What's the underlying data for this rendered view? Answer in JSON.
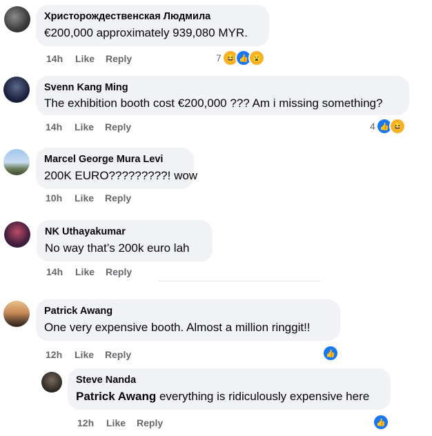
{
  "comments": [
    {
      "author": "Христорождественская Людмила",
      "text": "€200,000 approximately 939,080 MYR.",
      "time": "14h",
      "like": "Like",
      "reply": "Reply",
      "reaction_count": "7",
      "reactions": [
        "haha-icon",
        "like-icon",
        "wow-icon"
      ]
    },
    {
      "author": "Svenn Kang Ming",
      "text": "The exhibition booth cost €200,000 ??? Am i missing something?",
      "time": "14h",
      "like": "Like",
      "reply": "Reply",
      "reaction_count": "4",
      "reactions": [
        "like-icon",
        "haha-icon"
      ]
    },
    {
      "author": "Marcel George Mura Levi",
      "text": "200K EURO?????????! wow",
      "time": "10h",
      "like": "Like",
      "reply": "Reply"
    },
    {
      "author": "NK Uthayakumar",
      "text": "No way that’s 200k euro lah",
      "time": "14h",
      "like": "Like",
      "reply": "Reply"
    },
    {
      "author": "Patrick Awang",
      "text": "One very expensive booth. Almost a million ringgit!!",
      "time": "12h",
      "like": "Like",
      "reply": "Reply",
      "reactions": [
        "like-icon"
      ]
    }
  ],
  "reply_comment": {
    "author": "Steve Nanda",
    "mention": "Patrick Awang",
    "text": " everything is ridiculously expensive here",
    "time": "12h",
    "like": "Like",
    "reply": "Reply",
    "reactions": [
      "like-icon"
    ]
  },
  "colors": {
    "bubble": "#f0f2f5",
    "meta_text": "#65676b",
    "like_blue": "#1877f2",
    "reaction_yellow": "#f7b125"
  }
}
